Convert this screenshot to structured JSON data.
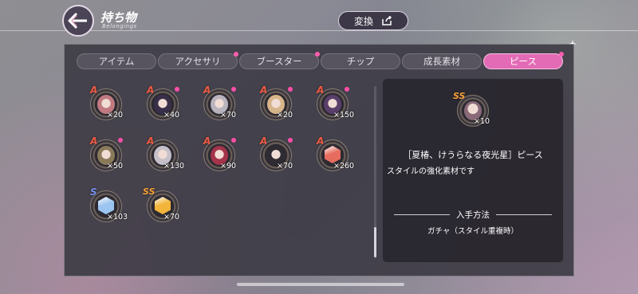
{
  "header": {
    "title": "持ち物",
    "subtitle": "Belongings",
    "convert_label": "変換"
  },
  "tabs": [
    {
      "label": "アイテム",
      "active": false,
      "notify": false
    },
    {
      "label": "アクセサリ",
      "active": false,
      "notify": true
    },
    {
      "label": "ブースター",
      "active": false,
      "notify": true
    },
    {
      "label": "チップ",
      "active": false,
      "notify": false
    },
    {
      "label": "成長素材",
      "active": false,
      "notify": false
    },
    {
      "label": "ピース",
      "active": true,
      "notify": true
    }
  ],
  "items": [
    {
      "rank": "A",
      "count": "×20",
      "notify": false,
      "kind": "portrait",
      "color": "#c07a80"
    },
    {
      "rank": "A",
      "count": "×40",
      "notify": true,
      "kind": "portrait",
      "color": "#3a2f4a"
    },
    {
      "rank": "A",
      "count": "×70",
      "notify": true,
      "kind": "portrait",
      "color": "#b8b3bd"
    },
    {
      "rank": "A",
      "count": "×20",
      "notify": true,
      "kind": "portrait",
      "color": "#d7b58a"
    },
    {
      "rank": "A",
      "count": "×150",
      "notify": true,
      "kind": "portrait",
      "color": "#5a3f6a"
    },
    {
      "rank": "A",
      "count": "×50",
      "notify": true,
      "kind": "portrait",
      "color": "#8a7a5a"
    },
    {
      "rank": "A",
      "count": "×130",
      "notify": false,
      "kind": "portrait",
      "color": "#c5c0c9"
    },
    {
      "rank": "A",
      "count": "×90",
      "notify": true,
      "kind": "portrait",
      "color": "#a4344a"
    },
    {
      "rank": "A",
      "count": "×70",
      "notify": true,
      "kind": "portrait",
      "color": "#2e2b33"
    },
    {
      "rank": "A",
      "count": "×260",
      "notify": false,
      "kind": "crystal",
      "color": "#e56c5e"
    },
    {
      "rank": "S",
      "count": "×103",
      "notify": false,
      "kind": "crystal",
      "color": "#9cc4f0"
    },
    {
      "rank": "SS",
      "count": "×70",
      "notify": false,
      "kind": "crystal",
      "color": "#f2b43a"
    }
  ],
  "detail": {
    "rank": "SS",
    "count": "×10",
    "name": "［夏椿、けうらなる夜光星］ピース",
    "description": "スタイルの強化素材です",
    "how_to_get_title": "入手方法",
    "how_to_get": "ガチャ（スタイル重複時）"
  },
  "icons": {
    "back": "back-arrow-icon",
    "convert": "convert-export-icon"
  }
}
